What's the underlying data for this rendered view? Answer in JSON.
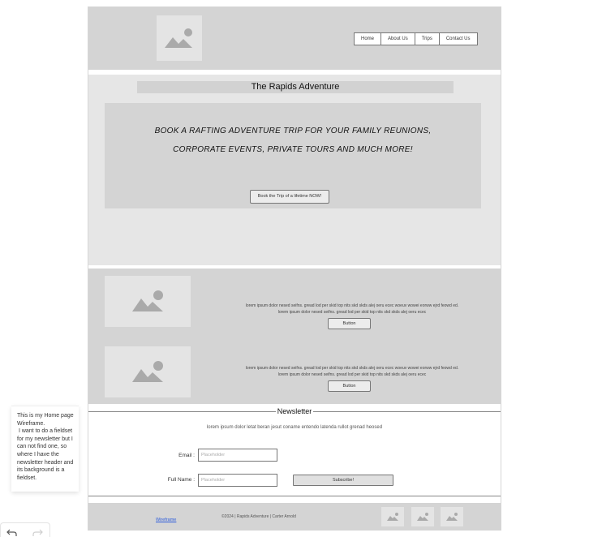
{
  "header": {
    "logo_icon": "image-placeholder-icon",
    "nav": [
      "Home",
      "About Us",
      "Trips",
      "Contact Us"
    ]
  },
  "hero": {
    "title": "The Rapids Adventure",
    "line1": "BOOK A RAFTING ADVENTURE TRIP FOR YOUR FAMILY REUNIONS,",
    "line2": "CORPORATE EVENTS, PRIVATE TOURS AND MUCH MORE!",
    "cta_label": "Book the Trip of a lifetime NOW!"
  },
  "features": [
    {
      "image_icon": "image-placeholder-icon",
      "text_line1": "lorem ipsum dolor nesed seifns. gread lod per skid top nits skd  skds alej oeru ecec woeuv wowei eorww ejrd feowd ed.",
      "text_line2": "lorem ipsum dolor nesed seifns. gread lod per skid top nits skd  skds alej oeru ecec",
      "button_label": "Button"
    },
    {
      "image_icon": "image-placeholder-icon",
      "text_line1": "lorem ipsum dolor nesed seifns. gread lod per skid top nits skd  skds alej oeru ecec woeuv wowei eorww ejrd feowd ed.",
      "text_line2": "lorem ipsum dolor nesed seifns. gread lod per skid top nits skd  skds alej oeru ecec",
      "button_label": "Button"
    }
  ],
  "newsletter": {
    "legend": "Newsletter",
    "description": "lorem ipsum dolor letat beran jesut coname entendo latenda rullot grenad heosed",
    "email_label": "Email :",
    "email_placeholder": "Placeholder",
    "name_label": "Full Name :",
    "name_placeholder": "Placeholder",
    "subscribe_label": "Subscribe!"
  },
  "footer": {
    "link": "Wireframe",
    "copyright": "©2024 | Rapids Adventure | Carter Arnold",
    "image_icons": [
      "image-placeholder-icon",
      "image-placeholder-icon",
      "image-placeholder-icon"
    ]
  },
  "comment": {
    "text": "This is my Home page Wireframe.\n I want to do a fieldset for my newsletter but I can not find one, so where I have the newsletter header and its background is a fieldset."
  },
  "toolbar": {
    "undo_icon": "undo-icon",
    "redo_icon": "redo-icon"
  },
  "colors": {
    "section_gray": "#d4d4d4",
    "hero_gray": "#e6e6e6",
    "placeholder_gray": "#e4e4e4",
    "link_blue": "#2a5adb"
  }
}
